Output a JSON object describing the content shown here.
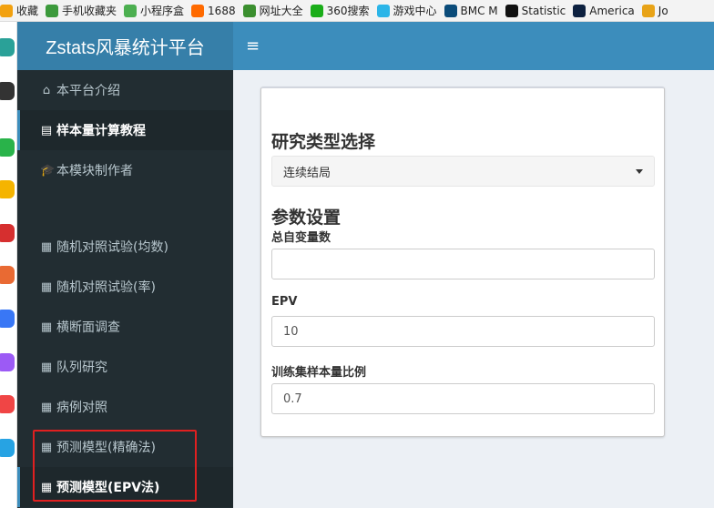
{
  "bookmarks": [
    {
      "label": "收藏",
      "icon": "star-icon",
      "color": "#f2a10f"
    },
    {
      "label": "手机收藏夹",
      "icon": "phone-icon",
      "color": "#3c9a3c"
    },
    {
      "label": "小程序盒",
      "icon": "miniprogram-icon",
      "color": "#4caf50"
    },
    {
      "label": "1688",
      "icon": "1688-icon",
      "color": "#ff6a00"
    },
    {
      "label": "网址大全",
      "icon": "plus-circle-icon",
      "color": "#3b8f2f"
    },
    {
      "label": "360搜索",
      "icon": "search-360-icon",
      "color": "#1aad19"
    },
    {
      "label": "游戏中心",
      "icon": "gamepad-icon",
      "color": "#2bb5e8"
    },
    {
      "label": "BMC M",
      "icon": "bmc-icon",
      "color": "#0b4c7a"
    },
    {
      "label": "Statistic",
      "icon": "w-icon",
      "color": "#111111"
    },
    {
      "label": "America",
      "icon": "circle-o-icon",
      "color": "#0d2140"
    },
    {
      "label": "Jo",
      "icon": "e-icon",
      "color": "#e8a317"
    }
  ],
  "leftbar_icons": [
    {
      "icon": "home-icon",
      "color": "#2aa198"
    },
    {
      "icon": "add-icon",
      "color": "#333333"
    },
    {
      "icon": "app-p-icon",
      "color": "#29b34a"
    },
    {
      "icon": "app-star-icon",
      "color": "#f5b400"
    },
    {
      "icon": "app-dots-icon",
      "color": "#d62f2f"
    },
    {
      "icon": "app-ai-icon",
      "color": "#e96a33"
    },
    {
      "icon": "app-ai2-icon",
      "color": "#3977f5"
    },
    {
      "icon": "app-chat-icon",
      "color": "#9c5af5"
    },
    {
      "icon": "app-game-icon",
      "color": "#f04545"
    },
    {
      "icon": "app-blue-icon",
      "color": "#27a3e3"
    }
  ],
  "brand": {
    "title": "Zstats风暴统计平台"
  },
  "navbar": {
    "toggle_glyph": "≡"
  },
  "sidebar": {
    "items": [
      {
        "label": "本平台介绍",
        "glyph": "⌂",
        "icon": "home-icon"
      },
      {
        "label": "样本量计算教程",
        "glyph": "▤",
        "icon": "building-icon"
      },
      {
        "label": "本模块制作者",
        "glyph": "🎓",
        "icon": "graduation-cap-icon"
      },
      {
        "label": "随机对照试验(均数)",
        "glyph": "▦",
        "icon": "calculator-icon"
      },
      {
        "label": "随机对照试验(率)",
        "glyph": "▦",
        "icon": "calculator-icon"
      },
      {
        "label": "横断面调查",
        "glyph": "▦",
        "icon": "calculator-icon"
      },
      {
        "label": "队列研究",
        "glyph": "▦",
        "icon": "calculator-icon"
      },
      {
        "label": "病例对照",
        "glyph": "▦",
        "icon": "calculator-icon"
      },
      {
        "label": "预测模型(精确法)",
        "glyph": "▦",
        "icon": "calculator-icon"
      },
      {
        "label": "预测模型(EPV法)",
        "glyph": "▦",
        "icon": "calculator-icon"
      }
    ]
  },
  "panel": {
    "study_type_heading": "研究类型选择",
    "study_type_selected": "连续结局",
    "params_heading": "参数设置",
    "fields": [
      {
        "label": "总自变量数",
        "value": "",
        "placeholder": ""
      },
      {
        "label": "EPV",
        "value": "10",
        "placeholder": ""
      },
      {
        "label": "训练集样本量比例",
        "value": "0.7",
        "placeholder": ""
      }
    ]
  },
  "colors": {
    "navbar": "#3c8dbc",
    "logo": "#367fa9",
    "sidebar": "#222d32",
    "active_item": "#1e282c",
    "highlight_box": "#e02020"
  }
}
